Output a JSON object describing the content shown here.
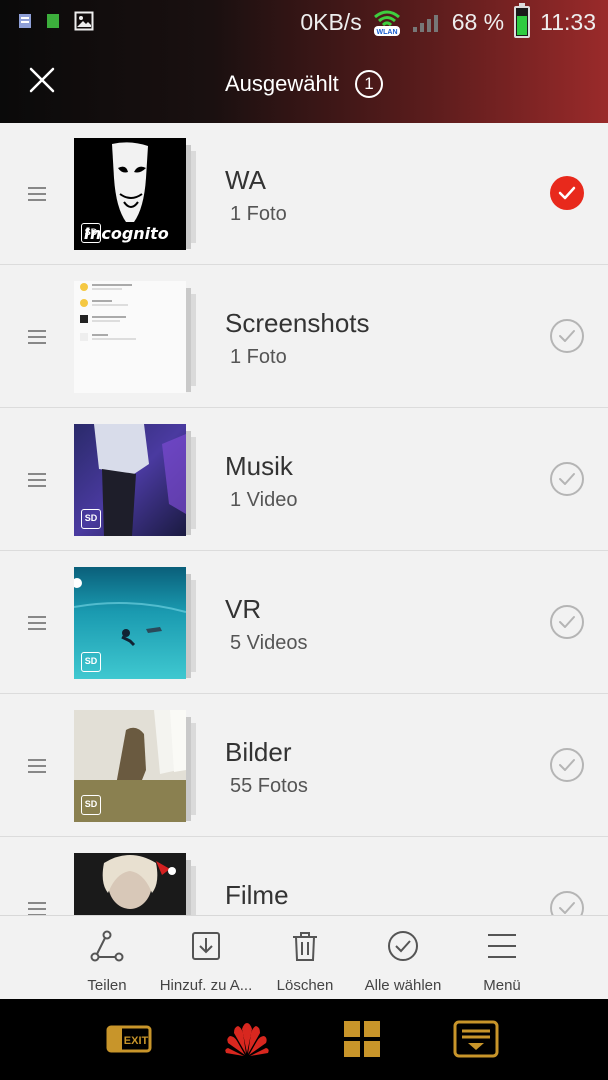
{
  "status_bar": {
    "net_speed": "0KB/s",
    "wifi_label": "WLAN",
    "battery_percent": "68 %",
    "battery_level": 0.68,
    "time": "11:33"
  },
  "header": {
    "title": "Ausgewählt",
    "selected_count": "1"
  },
  "albums": [
    {
      "name": "WA",
      "count": "1 Foto",
      "selected": true,
      "thumb_text": "Incognito",
      "sd_label": "SD"
    },
    {
      "name": "Screenshots",
      "count": "1 Foto",
      "selected": false
    },
    {
      "name": "Musik",
      "count": "1 Video",
      "selected": false,
      "sd_label": "SD"
    },
    {
      "name": "VR",
      "count": "5 Videos",
      "selected": false,
      "sd_label": "SD"
    },
    {
      "name": "Bilder",
      "count": "55 Fotos",
      "selected": false,
      "sd_label": "SD"
    },
    {
      "name": "Filme",
      "count": "",
      "selected": false
    }
  ],
  "toolbar": {
    "share": "Teilen",
    "add_to": "Hinzuf. zu A...",
    "delete": "Löschen",
    "select_all": "Alle wählen",
    "menu": "Menü"
  },
  "navbar": {
    "exit_label": "EXIT"
  },
  "colors": {
    "accent_red": "#e8291c",
    "header_gradient_end": "#9a2a2a"
  }
}
